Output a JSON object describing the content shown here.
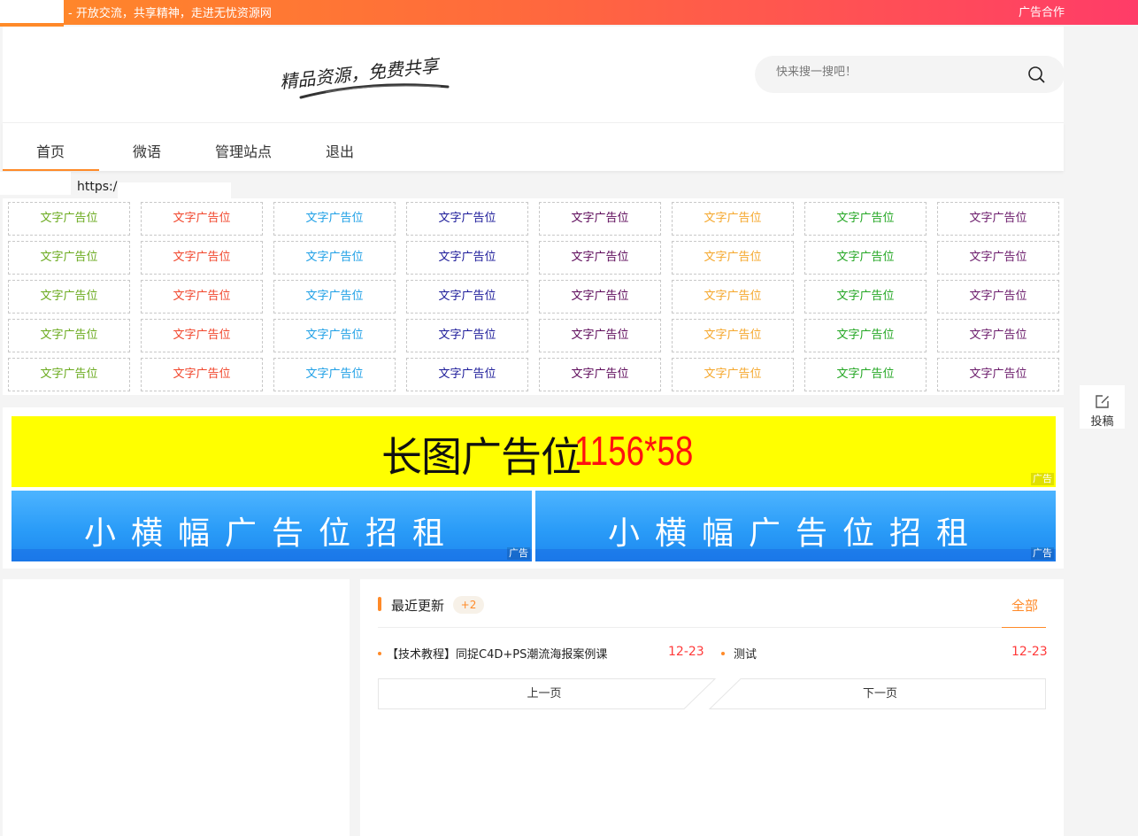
{
  "topbar": {
    "slogan": "- 开放交流，共享精神，走进无忧资源网",
    "ad_link": "广告合作"
  },
  "header": {
    "logo_text": "精品资源，免费共享",
    "search_placeholder": "快来搜一搜吧！"
  },
  "nav": {
    "items": [
      "首页",
      "微语",
      "管理站点",
      "退出"
    ],
    "active": "首页"
  },
  "url_display": "https:/,",
  "text_ads": {
    "label": "文字广告位",
    "rows": 5,
    "column_colors": [
      "#6aaa1d",
      "#f1452b",
      "#1d9fe6",
      "#1b1a99",
      "#5d0a5a",
      "#f5a72b",
      "#22a622",
      "#6a1a6a"
    ]
  },
  "banners": {
    "long": {
      "text": "长图广告位",
      "size": "1156*58",
      "tag": "广告"
    },
    "small": [
      {
        "text": "小横幅广告位招租",
        "tag": "广告"
      },
      {
        "text": "小横幅广告位招租",
        "tag": "广告"
      }
    ]
  },
  "recent": {
    "title": "最近更新",
    "badge": "+2",
    "all_link": "全部",
    "posts": [
      {
        "title": "【技术教程】同捉C4D+PS潮流海报案例课",
        "date": "12-23"
      },
      {
        "title": "测试",
        "date": "12-23"
      }
    ],
    "prev_label": "上一页",
    "next_label": "下一页"
  },
  "float_button": {
    "label": "投稿",
    "icon": "edit-icon"
  },
  "colors": {
    "accent": "#ff8a28",
    "gradient_end": "#ff3c68",
    "date_red": "#ff3a3a"
  }
}
